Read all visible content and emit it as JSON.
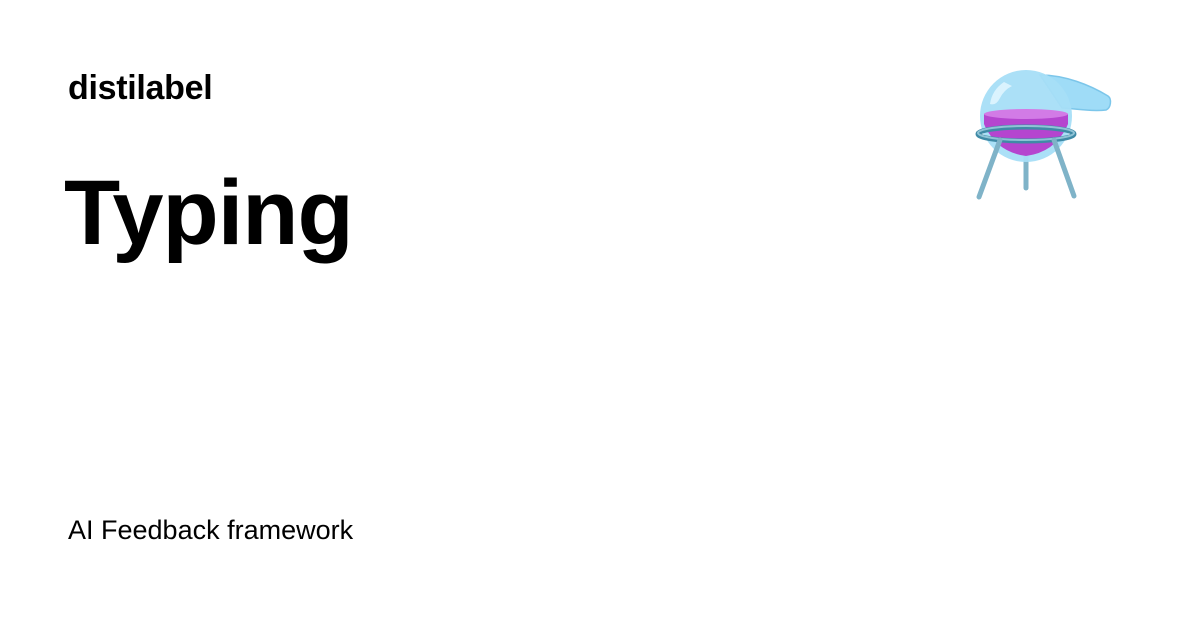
{
  "site": {
    "name": "distilabel",
    "description": "AI Feedback framework",
    "logo_icon": "flask-on-stand-icon"
  },
  "page": {
    "title": "Typing"
  },
  "colors": {
    "background": "#ffffff",
    "text": "#000000",
    "flask_glass": "#8fd3f4",
    "flask_liquid": "#b545cf",
    "stand": "#7fb3c8"
  }
}
